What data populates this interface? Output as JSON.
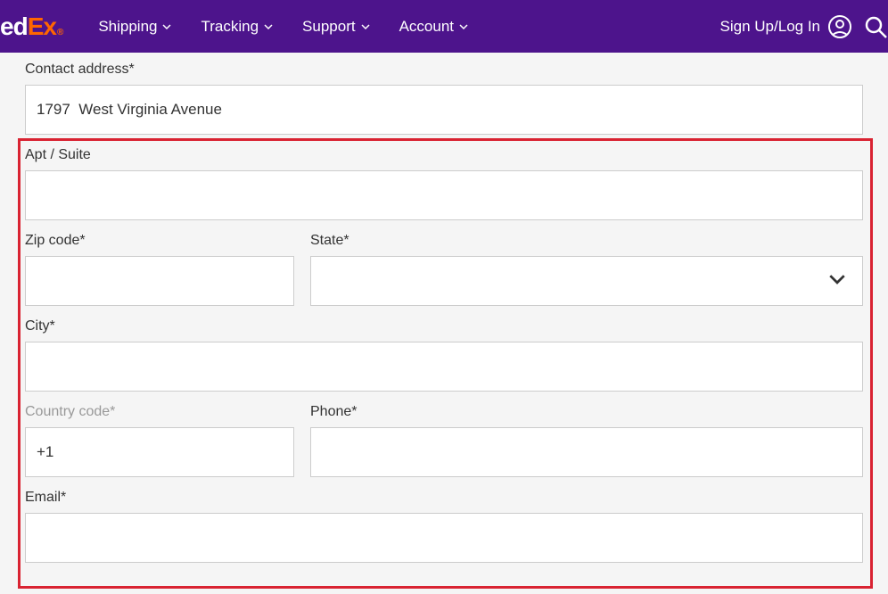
{
  "header": {
    "logo_fed": "ed",
    "logo_ex": "Ex",
    "nav": {
      "shipping": "Shipping",
      "tracking": "Tracking",
      "support": "Support",
      "account": "Account"
    },
    "signin": "Sign Up/Log In"
  },
  "form": {
    "contact_address_label": "Contact address*",
    "contact_address_value": "1797  West Virginia Avenue",
    "apt_suite_label": "Apt / Suite",
    "apt_suite_value": "",
    "zip_label": "Zip code*",
    "zip_value": "",
    "state_label": "State*",
    "state_value": "",
    "city_label": "City*",
    "city_value": "",
    "country_code_label": "Country code*",
    "country_code_value": "+1",
    "phone_label": "Phone*",
    "phone_value": "",
    "email_label": "Email*",
    "email_value": ""
  }
}
